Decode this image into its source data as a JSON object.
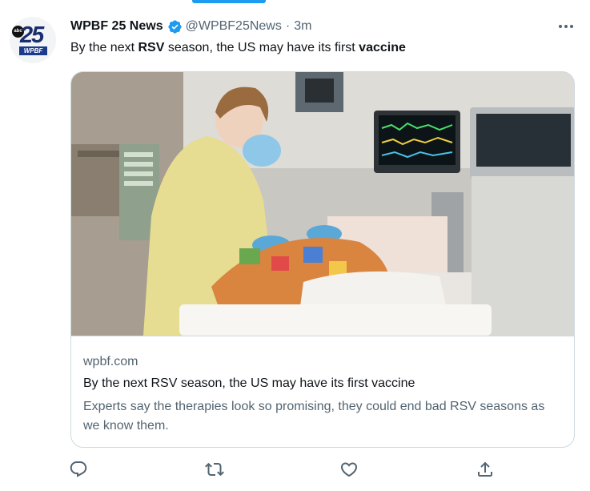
{
  "tweet": {
    "author_name": "WPBF 25 News",
    "handle": "@WPBF25News",
    "separator": "·",
    "time": "3m",
    "text_parts": [
      "By the next ",
      "RSV",
      " season, the US may have its first ",
      "vaccine"
    ]
  },
  "avatar": {
    "network": "abc",
    "number": "25",
    "call_sign": "WPBF"
  },
  "card": {
    "domain": "wpbf.com",
    "title": "By the next RSV season, the US may have its first vaccine",
    "description": "Experts say the therapies look so promising, they could end bad RSV seasons as we know them."
  },
  "colors": {
    "accent": "#1d9bf0",
    "secondary_text": "#536471",
    "border": "#cfd9de"
  },
  "icons": [
    "verified-badge-icon",
    "more-icon",
    "reply-icon",
    "retweet-icon",
    "like-icon",
    "share-icon"
  ]
}
